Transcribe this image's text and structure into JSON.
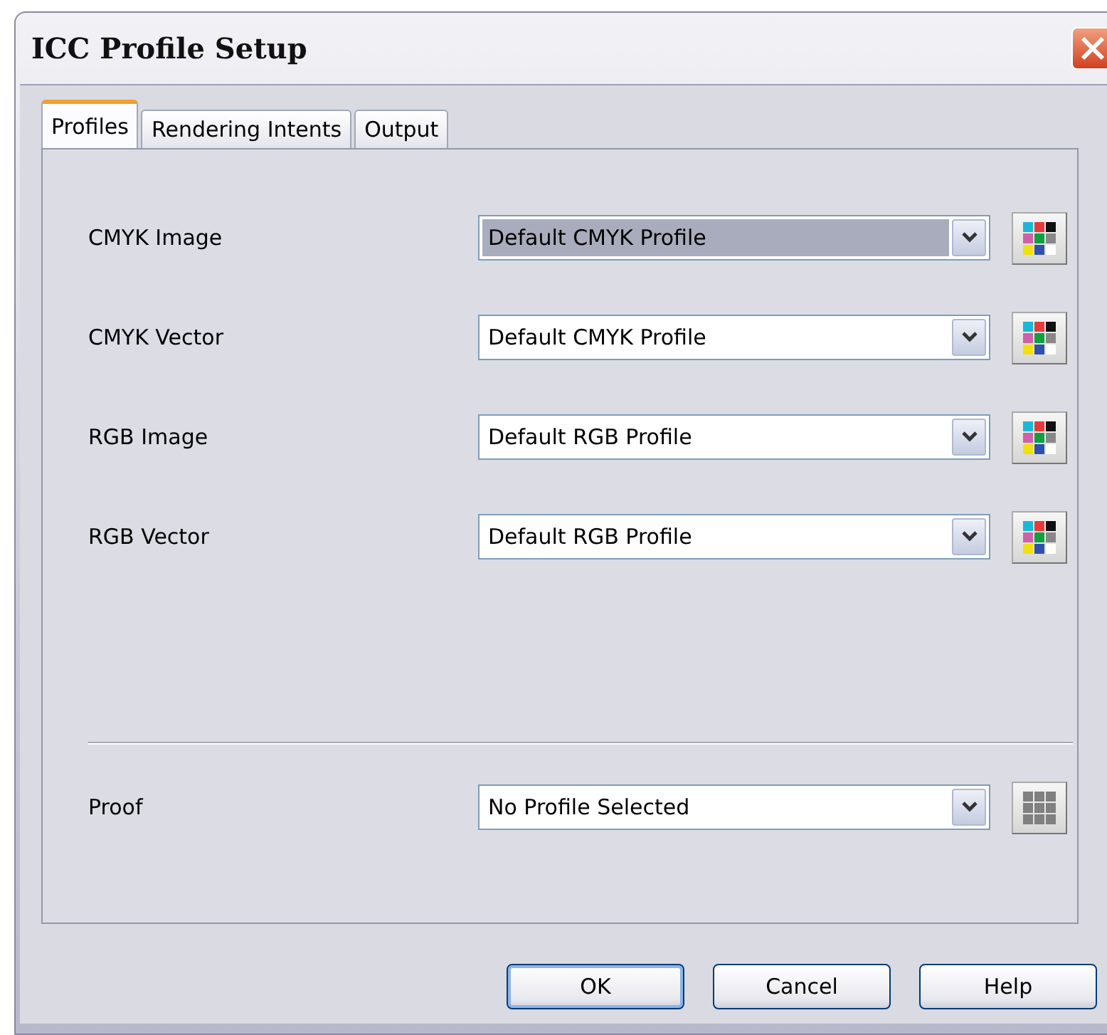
{
  "window": {
    "title": "ICC Profile Setup"
  },
  "tabs": [
    {
      "label": "Profiles",
      "selected": true
    },
    {
      "label": "Rendering Intents",
      "selected": false
    },
    {
      "label": "Output",
      "selected": false
    }
  ],
  "profiles": [
    {
      "label": "CMYK Image",
      "value": "Default CMYK Profile",
      "focused": true,
      "picker_enabled": true
    },
    {
      "label": "CMYK Vector",
      "value": "Default CMYK Profile",
      "focused": false,
      "picker_enabled": true
    },
    {
      "label": "RGB Image",
      "value": "Default RGB Profile",
      "focused": false,
      "picker_enabled": true
    },
    {
      "label": "RGB Vector",
      "value": "Default RGB Profile",
      "focused": false,
      "picker_enabled": true
    }
  ],
  "proof": {
    "label": "Proof",
    "value": "No Profile Selected",
    "focused": false,
    "picker_enabled": false
  },
  "buttons": [
    "OK",
    "Cancel",
    "Help"
  ]
}
